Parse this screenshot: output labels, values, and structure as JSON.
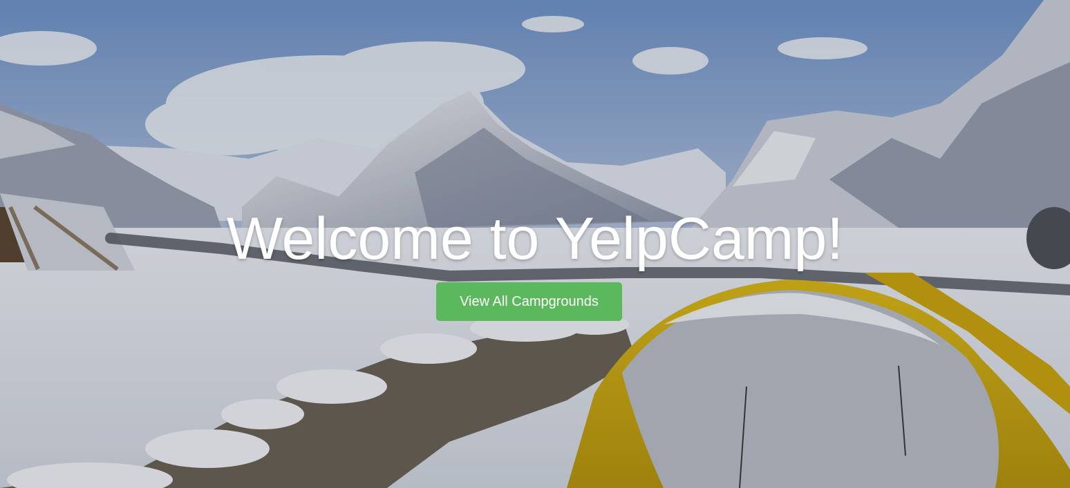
{
  "hero": {
    "title": "Welcome to YelpCamp!",
    "button_label": "View All Campgrounds",
    "button_color": "#5cb85c",
    "background_image": "snowy-mountain-campsite-with-tent"
  }
}
